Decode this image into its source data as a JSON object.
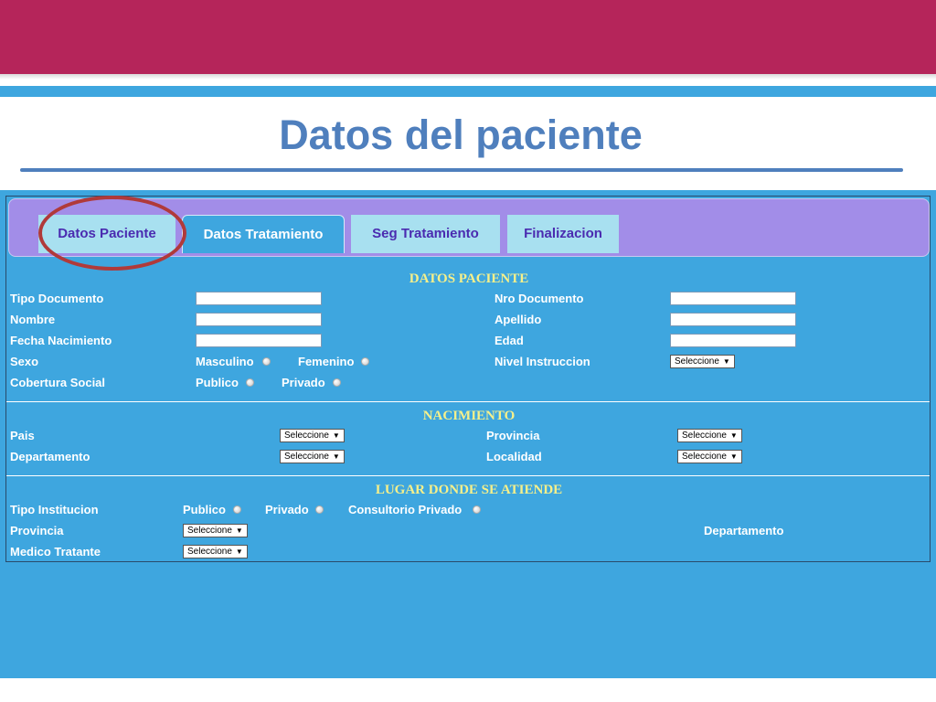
{
  "slide": {
    "title": "Datos del paciente"
  },
  "tabs": [
    {
      "label": "Datos Paciente"
    },
    {
      "label": "Datos Tratamiento"
    },
    {
      "label": "Seg Tratamiento"
    },
    {
      "label": "Finalizacion"
    }
  ],
  "datos_paciente": {
    "title": "DATOS PACIENTE",
    "tipo_documento": "Tipo Documento",
    "nro_documento": "Nro Documento",
    "nombre": "Nombre",
    "apellido": "Apellido",
    "fecha_nacimiento": "Fecha Nacimiento",
    "edad": "Edad",
    "sexo": "Sexo",
    "masculino": "Masculino",
    "femenino": "Femenino",
    "nivel_instruccion": "Nivel Instruccion",
    "nivel_select": "Seleccione",
    "cobertura_social": "Cobertura Social",
    "publico": "Publico",
    "privado": "Privado"
  },
  "nacimiento": {
    "title": "NACIMIENTO",
    "pais": "Pais",
    "pais_select": "Seleccione",
    "provincia": "Provincia",
    "provincia_select": "Seleccione",
    "departamento": "Departamento",
    "departamento_select": "Seleccione",
    "localidad": "Localidad",
    "localidad_select": "Seleccione"
  },
  "lugar": {
    "title": "LUGAR DONDE SE ATIENDE",
    "tipo_institucion": "Tipo Institucion",
    "publico": "Publico",
    "privado": "Privado",
    "consultorio": "Consultorio Privado",
    "provincia": "Provincia",
    "provincia_select": "Seleccione",
    "departamento": "Departamento",
    "medico": "Medico Tratante",
    "medico_select": "Seleccione"
  },
  "colors": {
    "banner": "#b5255a",
    "accent_blue": "#3ea6df",
    "title_blue": "#4f7fbd",
    "tabbar_purple": "#a28de8",
    "section_yellow": "#f6f08a",
    "highlight_circle": "#b03a3a"
  }
}
